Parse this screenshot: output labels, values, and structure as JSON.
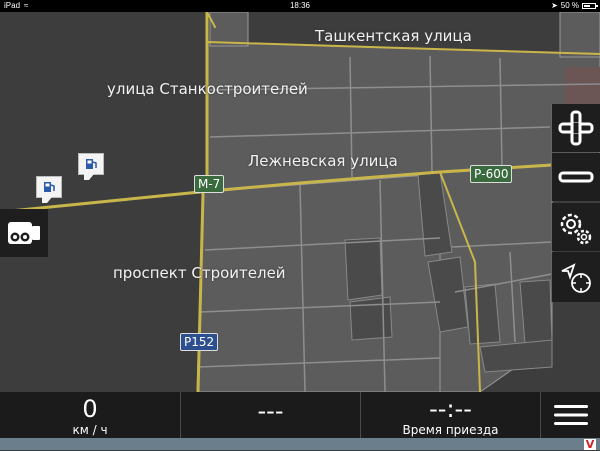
{
  "status_bar": {
    "device": "iPad",
    "time": "18:36",
    "battery": "50 %",
    "battery_level": 0.5
  },
  "map": {
    "labels": {
      "tashkent": "Ташкентская улица",
      "stankostroitelei": "улица Станкостроителей",
      "lezhnevskaya": "Лежневская улица",
      "stroitelei": "проспект Строителей"
    },
    "road_badges": {
      "m7": "М-7",
      "p600": "Р-600",
      "p152": "Р152"
    },
    "colors": {
      "background": "#3d3d3d",
      "block": "#5c5c5c",
      "major_road": "#c9b64a",
      "minor_road": "#8a8a8a",
      "badge_green": "#3a6b3e",
      "badge_blue": "#2c4f8f"
    }
  },
  "controls": {
    "zoom_in_icon": "plus-icon",
    "zoom_out_icon": "minus-icon",
    "settings_icon": "gear-icon",
    "location_icon": "compass-icon",
    "camera_icon": "speed-camera-icon"
  },
  "bottom_bar": {
    "speed_value": "0",
    "speed_unit": "км / ч",
    "distance_value": "---",
    "arrival_value": "--:--",
    "arrival_label": "Время приезда",
    "menu_icon": "hamburger-icon"
  },
  "footer": {
    "logo_letter": "V"
  }
}
